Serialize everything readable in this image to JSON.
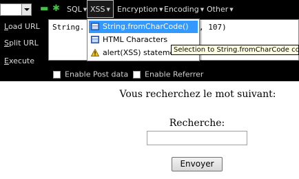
{
  "toolbar": {
    "menus": [
      {
        "label": "SQL"
      },
      {
        "label": "XSS"
      },
      {
        "label": "Encryption"
      },
      {
        "label": "Encoding"
      },
      {
        "label": "Other"
      }
    ],
    "icons": [
      "minus-icon",
      "asterisk-icon"
    ]
  },
  "sidebar": {
    "load_url": {
      "underlined": "L",
      "rest": "oad URL"
    },
    "split_url": {
      "underlined": "S",
      "rest": "plit URL"
    },
    "execute": {
      "underlined": "E",
      "rest": "xecute"
    }
  },
  "editor": {
    "text_left": "String.",
    "text_right": ", 107)"
  },
  "options": {
    "post": "Enable Post data",
    "referrer": "Enable Referrer"
  },
  "xss_menu": {
    "items": [
      {
        "label": "String.fromCharCode()",
        "icon": "function-icon",
        "selected": true
      },
      {
        "label": "HTML Characters",
        "icon": "function-icon",
        "selected": false
      },
      {
        "label": "alert(XSS) statement",
        "icon": "warning-icon",
        "selected": false
      }
    ],
    "tooltip": "Selection to String.fromCharCode conv"
  },
  "page": {
    "heading": "Vous recherchez le mot suivant:",
    "search_label": "Recherche:",
    "search_value": "",
    "submit_label": "Envoyer"
  },
  "colors": {
    "toolbar_bg": "#000000",
    "menu_text": "#dcdcdc",
    "selection": "#3399ff",
    "tooltip_bg": "#ffffe1",
    "toolbar_icon": "#44c144"
  }
}
